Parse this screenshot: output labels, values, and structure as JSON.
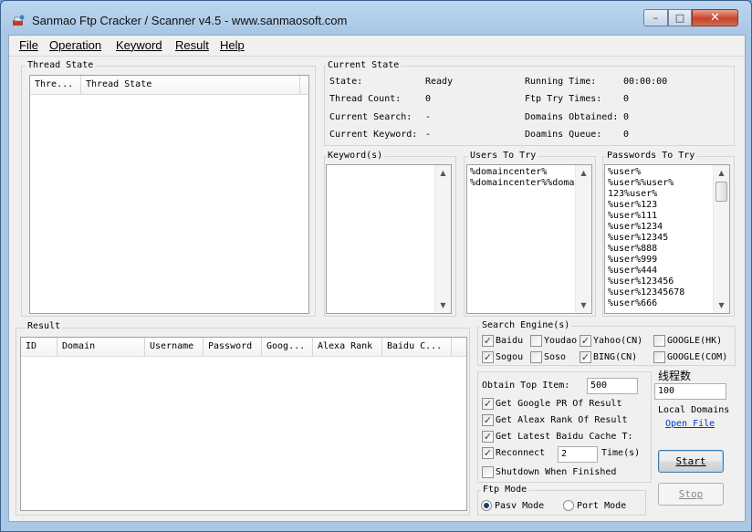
{
  "window": {
    "title": "Sanmao Ftp Cracker / Scanner v4.5 - www.sanmaosoft.com",
    "min": "–",
    "max": "□",
    "close": "✕"
  },
  "menu": [
    "File",
    "Operation",
    "Keyword",
    "Result",
    "Help"
  ],
  "thread_state": {
    "title": "Thread State",
    "columns": [
      "Thre...",
      "Thread State"
    ]
  },
  "current_state": {
    "title": "Current State",
    "state_label": "State:",
    "state_value": "Ready",
    "thread_count_label": "Thread Count:",
    "thread_count_value": "0",
    "current_search_label": "Current Search:",
    "current_search_value": "-",
    "current_keyword_label": "Current Keyword:",
    "current_keyword_value": "-",
    "running_time_label": "Running Time:",
    "running_time_value": "00:00:00",
    "ftp_try_label": "Ftp Try Times:",
    "ftp_try_value": "0",
    "domains_obtained_label": "Domains Obtained:",
    "domains_obtained_value": "0",
    "domains_queue_label": "Doamins Queue:",
    "domains_queue_value": "0"
  },
  "keywords": {
    "title": "Keyword(s)"
  },
  "users": {
    "title": "Users To Try",
    "items": [
      "%domaincenter%",
      "%domaincenter%%doma"
    ]
  },
  "passwords": {
    "title": "Passwords To Try",
    "items": [
      "%user%",
      "%user%%user%",
      "123%user%",
      "%user%123",
      "%user%111",
      "%user%1234",
      "%user%12345",
      "%user%888",
      "%user%999",
      "%user%444",
      "%user%123456",
      "%user%12345678",
      "%user%666"
    ]
  },
  "result": {
    "title": "Result",
    "columns": [
      "ID",
      "Domain",
      "Username",
      "Password",
      "Goog...",
      "Alexa Rank",
      "Baidu C..."
    ]
  },
  "search_engine": {
    "title": "Search Engine(s)",
    "baidu": "Baidu",
    "youdao": "Youdao",
    "yahoo": "Yahoo(CN)",
    "google_hk": "GOOGLE(HK)",
    "sogou": "Sogou",
    "soso": "Soso",
    "bing": "BING(CN)",
    "google_com": "GOOGLE(COM)"
  },
  "options": {
    "obtain_top_label": "Obtain Top Item:",
    "obtain_top_value": "500",
    "get_pr": "Get Google PR Of Result",
    "get_alexa": "Get Aleax Rank Of Result",
    "get_baidu": "Get Latest Baidu Cache T:",
    "reconnect": "Reconnect",
    "reconnect_value": "2",
    "time_unit": "Time(s)",
    "shutdown": "Shutdown When Finished"
  },
  "threads": {
    "label": "线程数",
    "value": "100"
  },
  "local_domains": {
    "label": "Local Domains",
    "open_file": "Open File"
  },
  "ftp_mode": {
    "title": "Ftp Mode",
    "pasv": "Pasv Mode",
    "port": "Port Mode"
  },
  "buttons": {
    "start": "Start",
    "stop": "Stop"
  }
}
